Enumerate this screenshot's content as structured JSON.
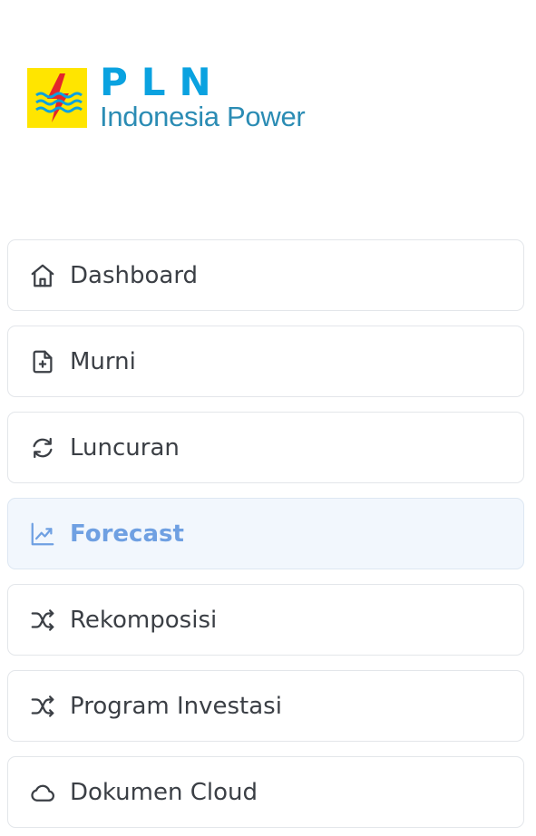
{
  "logo": {
    "brand": "PLN",
    "subtitle": "Indonesia Power",
    "mark_icon": "pln-lightning-icon",
    "colors": {
      "yellow": "#ffe500",
      "red": "#e3262b",
      "blue": "#0aa2e0"
    }
  },
  "nav": {
    "active_index": 3,
    "accent_color": "#6fa0e2",
    "items": [
      {
        "label": "Dashboard",
        "icon": "home-icon"
      },
      {
        "label": "Murni",
        "icon": "file-plus-icon"
      },
      {
        "label": "Luncuran",
        "icon": "refresh-icon"
      },
      {
        "label": "Forecast",
        "icon": "trending-chart-icon"
      },
      {
        "label": "Rekomposisi",
        "icon": "shuffle-icon"
      },
      {
        "label": "Program Investasi",
        "icon": "shuffle-icon"
      },
      {
        "label": "Dokumen Cloud",
        "icon": "cloud-icon"
      }
    ]
  }
}
